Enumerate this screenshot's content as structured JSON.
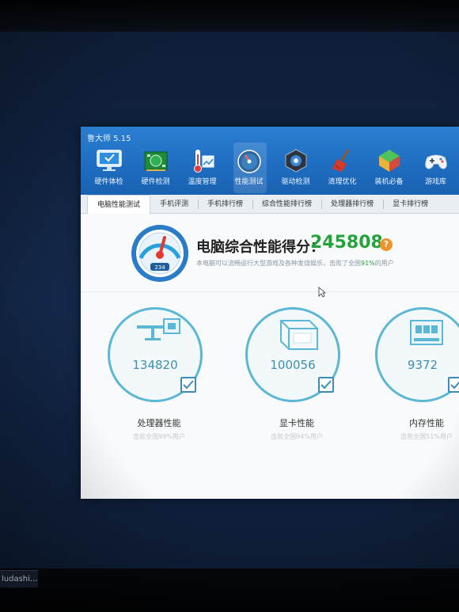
{
  "app": {
    "title": "鲁大师 5.15"
  },
  "toolbar": {
    "items": [
      {
        "label": "硬件体检",
        "icon": "monitor-icon"
      },
      {
        "label": "硬件检测",
        "icon": "circuit-board-icon"
      },
      {
        "label": "温度管理",
        "icon": "thermometer-icon"
      },
      {
        "label": "性能测试",
        "icon": "speedometer-icon",
        "active": true
      },
      {
        "label": "驱动检测",
        "icon": "gear-shield-icon"
      },
      {
        "label": "清理优化",
        "icon": "broom-icon"
      },
      {
        "label": "装机必备",
        "icon": "cube-icon"
      },
      {
        "label": "游戏库",
        "icon": "gamepad-icon"
      }
    ]
  },
  "tabs": [
    {
      "label": "电脑性能测试",
      "active": true
    },
    {
      "label": "手机评测"
    },
    {
      "label": "手机排行榜"
    },
    {
      "label": "综合性能排行榜"
    },
    {
      "label": "处理器排行榜"
    },
    {
      "label": "显卡排行榜"
    }
  ],
  "score": {
    "title": "电脑综合性能得分：",
    "value": "245808",
    "help": "?",
    "desc_prefix": "本电脑可以流畅运行大型游戏及各种发烧娱乐，击败了全国",
    "desc_pct": "91%",
    "desc_suffix": "的用户",
    "gauge_readout": "234"
  },
  "metrics": [
    {
      "value": "134820",
      "name": "处理器性能",
      "sub": "击败全国99%用户"
    },
    {
      "value": "100056",
      "name": "显卡性能",
      "sub": "击败全国94%用户"
    },
    {
      "value": "9372",
      "name": "内存性能",
      "sub": "击败全国51%用户"
    }
  ],
  "taskbar": {
    "item": "ludashi...."
  },
  "colors": {
    "titlebar": "#1e6cc0",
    "score_green": "#24a33a",
    "ring": "#5bb7d6",
    "help_orange": "#f0932b"
  }
}
